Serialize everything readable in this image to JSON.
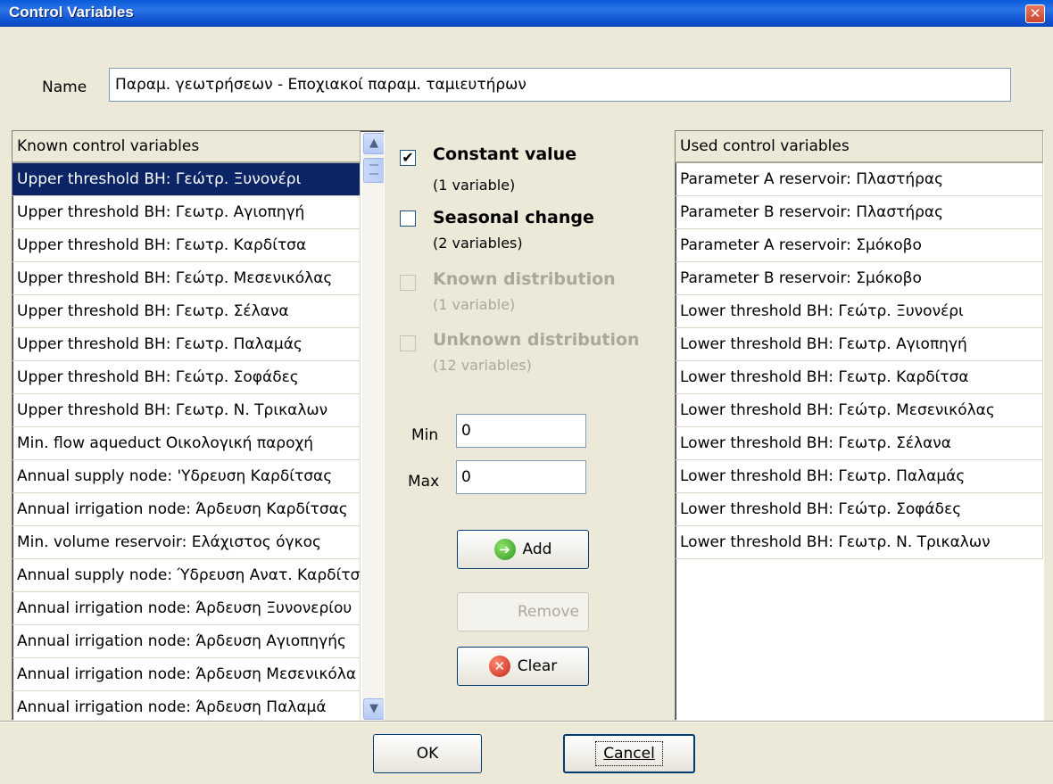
{
  "window": {
    "title": "Control Variables",
    "close_glyph": "✕"
  },
  "name": {
    "label": "Name",
    "value": "Παραμ. γεωτρήσεων - Εποχιακοί παραμ. ταμιευτήρων"
  },
  "known": {
    "header": "Known control variables",
    "items": [
      "Upper threshold BH: Γεώτρ. Ξυνονέρι",
      "Upper threshold BH: Γεωτρ. Αγιοπηγή",
      "Upper threshold BH: Γεωτρ. Καρδίτσα",
      "Upper threshold BH: Γεώτρ. Μεσενικόλας",
      "Upper threshold BH: Γεωτρ. Σέλανα",
      "Upper threshold BH: Γεωτρ. Παλαμάς",
      "Upper threshold BH: Γεώτρ. Σοφάδες",
      "Upper threshold BH: Γεωτρ. Ν. Τρικαλων",
      "Min. flow aqueduct Οικολογική παροχή",
      "Annual supply node: 'Υδρευση Καρδίτσας",
      "Annual irrigation node: Άρδευση Καρδίτσας",
      "Min. volume reservoir: Ελάχιστος όγκος",
      "Annual supply node: Ύδρευση Ανατ. Καρδίτσας",
      "Annual irrigation node: Άρδευση Ξυνονερίου",
      "Annual irrigation node: Άρδευση Αγιοπηγής",
      "Annual irrigation node: Άρδευση Μεσενικόλα",
      "Annual irrigation node: Άρδευση Παλαμά"
    ]
  },
  "options": {
    "constant": {
      "title": "Constant value",
      "sub": "(1 variable)",
      "checked_glyph": "✔"
    },
    "seasonal": {
      "title": "Seasonal change",
      "sub": "(2 variables)"
    },
    "known_dist": {
      "title": "Known distribution",
      "sub": "(1 variable)"
    },
    "unknown_dist": {
      "title": "Unknown distribution",
      "sub": "(12 variables)"
    }
  },
  "range": {
    "min_label": "Min",
    "min_value": "0",
    "max_label": "Max",
    "max_value": "0"
  },
  "buttons": {
    "add": "Add",
    "add_icon": "➔",
    "remove": "Remove",
    "clear": "Clear",
    "clear_icon": "✕",
    "ok": "OK",
    "cancel": "Cancel"
  },
  "used": {
    "header": "Used control variables",
    "items": [
      "Parameter A reservoir: Πλαστήρας",
      "Parameter B reservoir: Πλαστήρας",
      "Parameter A reservoir: Σμόκοβο",
      "Parameter B reservoir: Σμόκοβο",
      "Lower threshold BH: Γεώτρ. Ξυνονέρι",
      "Lower threshold BH: Γεωτρ. Αγιοπηγή",
      "Lower threshold BH: Γεωτρ. Καρδίτσα",
      "Lower threshold BH: Γεώτρ. Μεσενικόλας",
      "Lower threshold BH: Γεωτρ. Σέλανα",
      "Lower threshold BH: Γεωτρ. Παλαμάς",
      "Lower threshold BH: Γεώτρ. Σοφάδες",
      "Lower threshold BH: Γεωτρ. Ν. Τρικαλων"
    ]
  }
}
